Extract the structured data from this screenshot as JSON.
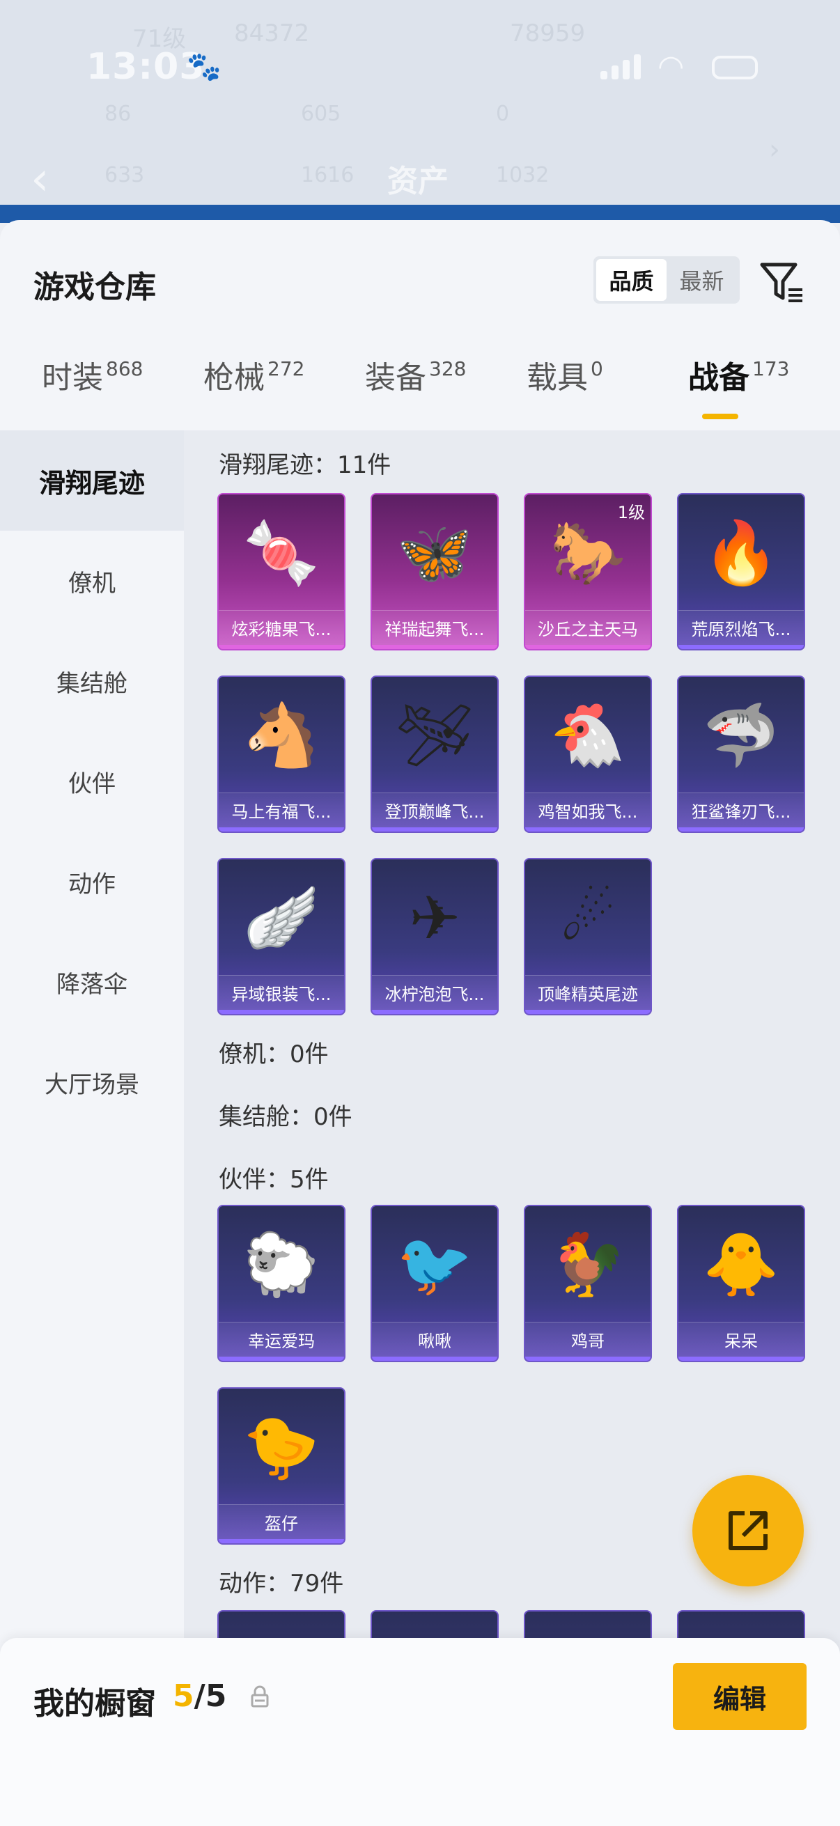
{
  "status": {
    "time": "13:03"
  },
  "header": {
    "title": "资产",
    "faint_level": "71级",
    "faint_id": "84372",
    "faint_score": "78959",
    "faint_stats": [
      "86",
      "605",
      "0",
      "633",
      "1616",
      "1032"
    ]
  },
  "sheet": {
    "title": "游戏仓库",
    "sort_options": [
      "品质",
      "最新"
    ],
    "sort_active": "品质"
  },
  "tabs": [
    {
      "label": "时装",
      "count": "868"
    },
    {
      "label": "枪械",
      "count": "272"
    },
    {
      "label": "装备",
      "count": "328"
    },
    {
      "label": "载具",
      "count": "0"
    },
    {
      "label": "战备",
      "count": "173"
    }
  ],
  "active_tab": "战备",
  "sidebar": [
    "滑翔尾迹",
    "僚机",
    "集结舱",
    "伙伴",
    "动作",
    "降落伞",
    "大厅场景"
  ],
  "sections": {
    "trail": {
      "title": "滑翔尾迹：11件"
    },
    "wingman": {
      "title": "僚机：0件"
    },
    "pod": {
      "title": "集结舱：0件"
    },
    "partner": {
      "title": "伙伴：5件"
    },
    "action": {
      "title": "动作：79件"
    }
  },
  "trail_items": [
    {
      "name": "炫彩糖果飞...",
      "quality": "pink",
      "icon": "candy-glider-icon"
    },
    {
      "name": "祥瑞起舞飞...",
      "quality": "pink",
      "icon": "dragonfly-glider-icon"
    },
    {
      "name": "沙丘之主天马",
      "quality": "pink",
      "icon": "pegasus-chariot-icon",
      "level": "1级"
    },
    {
      "name": "荒原烈焰飞...",
      "quality": "purple",
      "icon": "flame-glider-icon"
    },
    {
      "name": "马上有福飞...",
      "quality": "purple",
      "icon": "horse-glider-icon"
    },
    {
      "name": "登顶巅峰飞...",
      "quality": "purple",
      "icon": "jet-glider-icon"
    },
    {
      "name": "鸡智如我飞...",
      "quality": "purple",
      "icon": "chicken-glider-icon"
    },
    {
      "name": "狂鲨锋刃飞...",
      "quality": "purple",
      "icon": "shark-glider-icon"
    },
    {
      "name": "异域银装飞...",
      "quality": "purple",
      "icon": "silver-glider-icon"
    },
    {
      "name": "冰柠泡泡飞...",
      "quality": "purple",
      "icon": "plane-glider-icon"
    },
    {
      "name": "顶峰精英尾迹",
      "quality": "purple",
      "icon": "smoke-trail-icon"
    }
  ],
  "partner_items": [
    {
      "name": "幸运爱玛",
      "icon": "lamb-partner-icon"
    },
    {
      "name": "啾啾",
      "icon": "pink-bird-partner-icon"
    },
    {
      "name": "鸡哥",
      "icon": "rooster-partner-icon"
    },
    {
      "name": "呆呆",
      "icon": "chick-partner-icon"
    },
    {
      "name": "盔仔",
      "icon": "helmet-chick-partner-icon"
    }
  ],
  "showcase": {
    "label": "我的橱窗",
    "current": "5",
    "sep": "/",
    "total": "5",
    "edit": "编辑"
  },
  "colors": {
    "accent": "#f7b30f",
    "pink_quality": "#c04ad0",
    "purple_quality": "#6e56c8"
  }
}
